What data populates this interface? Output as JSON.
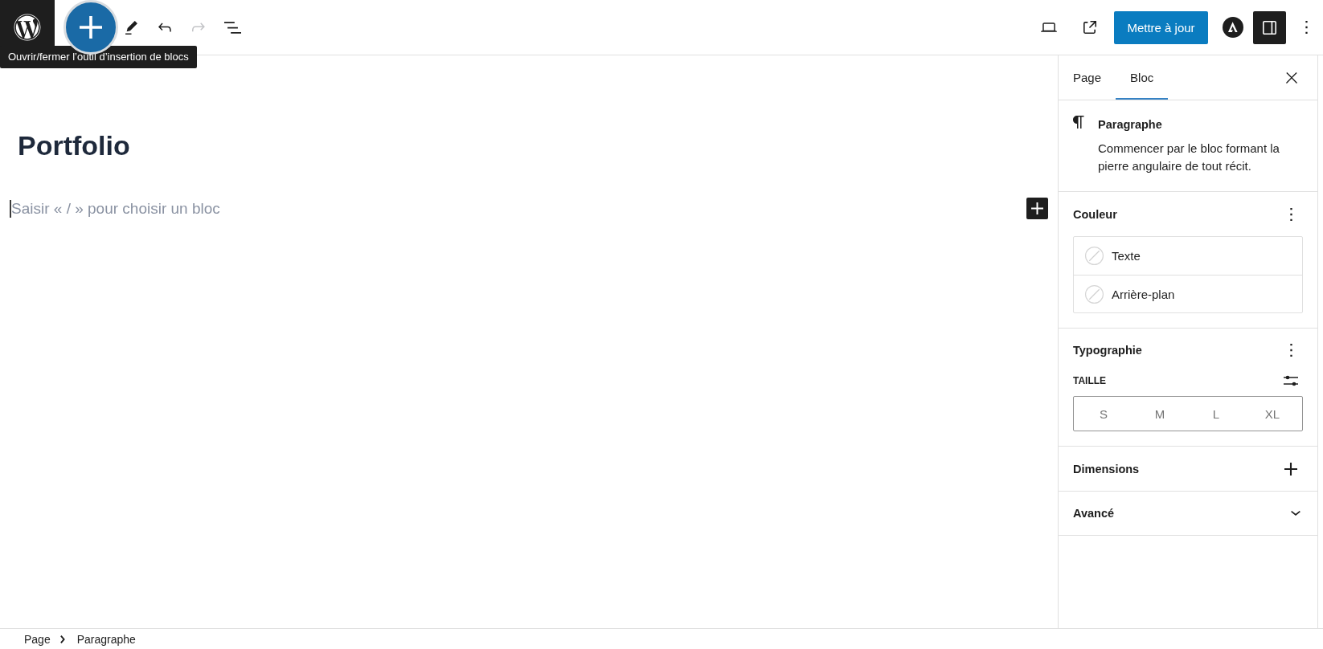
{
  "header": {
    "inserter_tooltip": "Ouvrir/fermer l’outil d’insertion de blocs",
    "undo": {
      "disabled": false
    },
    "redo": {
      "disabled": true
    },
    "update_button": "Mettre à jour",
    "settings_toggle": {
      "pressed": true
    }
  },
  "editor": {
    "title": "Portfolio",
    "placeholder": "Saisir « / » pour choisir un bloc"
  },
  "sidebar": {
    "tabs": [
      {
        "label": "Page",
        "selected": false
      },
      {
        "label": "Bloc",
        "selected": true
      }
    ],
    "block_card": {
      "title": "Paragraphe",
      "description": "Commencer par le bloc formant la pierre angulaire de tout récit."
    },
    "panels": [
      {
        "kind": "color",
        "title": "Couleur",
        "options": [
          "Texte",
          "Arrière-plan"
        ]
      },
      {
        "kind": "typography",
        "title": "Typographie",
        "size_label": "TAILLE",
        "sizes": [
          {
            "label": "S",
            "selected": false
          },
          {
            "label": "M",
            "selected": false
          },
          {
            "label": "L",
            "selected": false
          },
          {
            "label": "XL",
            "selected": false
          }
        ]
      },
      {
        "kind": "dimensions",
        "title": "Dimensions"
      },
      {
        "kind": "advanced",
        "title": "Avancé",
        "expanded": false
      }
    ]
  },
  "breadcrumb": [
    "Page",
    "Paragraphe"
  ]
}
